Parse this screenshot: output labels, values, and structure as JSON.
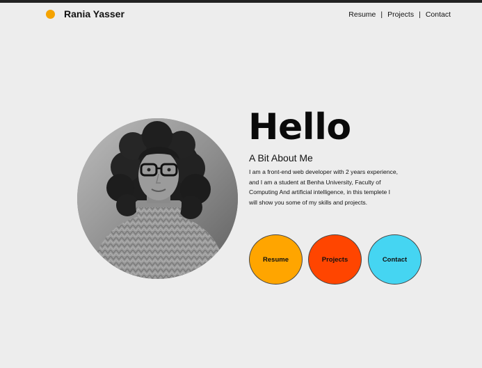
{
  "header": {
    "brand": "Rania Yasser",
    "nav": [
      {
        "label": "Resume"
      },
      {
        "label": "Projects"
      },
      {
        "label": "Contact"
      }
    ],
    "separator": "|"
  },
  "hero": {
    "greeting": "Hello",
    "about_title": "A Bit About Me",
    "about_text": "I am a front-end web developer with 2 years experience, and I am a student at Benha University, Faculty of Computing And artificial intelligence, in this templete I will show you some of my skills and projects.",
    "buttons": [
      {
        "label": "Resume",
        "color": "#ffa500"
      },
      {
        "label": "Projects",
        "color": "#ff4500"
      },
      {
        "label": "Contact",
        "color": "#45d5f2"
      }
    ]
  },
  "colors": {
    "accent_dot": "#f5a300",
    "background": "#ededed"
  }
}
